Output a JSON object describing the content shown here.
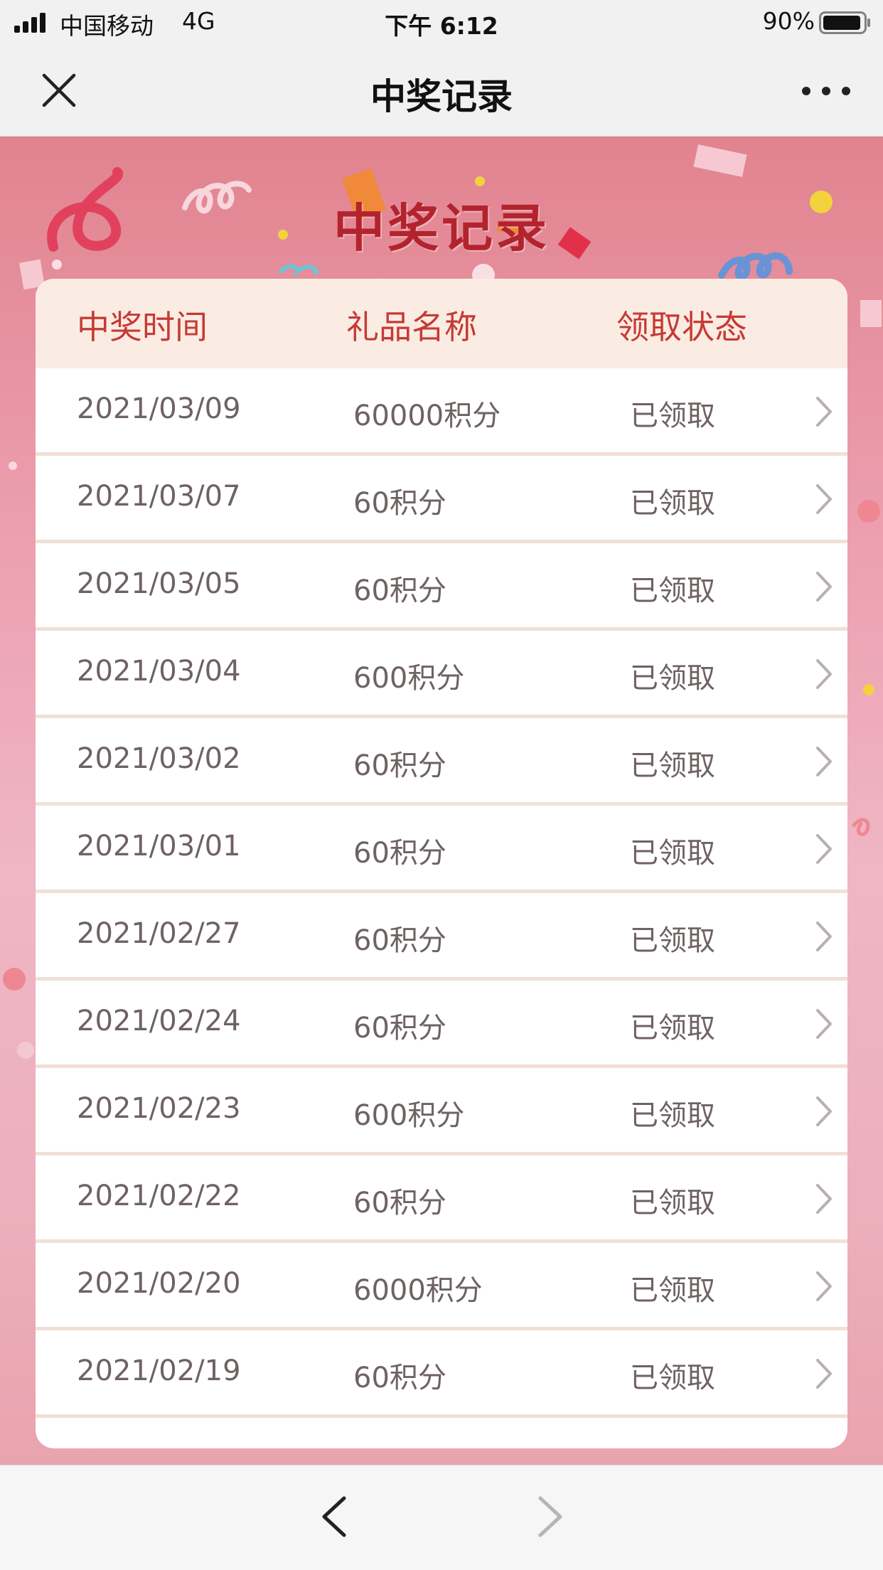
{
  "status_bar": {
    "carrier": "中国移动",
    "network": "4G",
    "time": "下午 6:12",
    "battery": "90%"
  },
  "nav": {
    "title": "中奖记录",
    "close_icon": "close-icon",
    "more_icon": "more-icon"
  },
  "banner": {
    "title": "中奖记录"
  },
  "table": {
    "headers": {
      "time": "中奖时间",
      "gift": "礼品名称",
      "status": "领取状态"
    },
    "rows": [
      {
        "date": "2021/03/09",
        "gift": "60000积分",
        "status": "已领取"
      },
      {
        "date": "2021/03/07",
        "gift": "60积分",
        "status": "已领取"
      },
      {
        "date": "2021/03/05",
        "gift": "60积分",
        "status": "已领取"
      },
      {
        "date": "2021/03/04",
        "gift": "600积分",
        "status": "已领取"
      },
      {
        "date": "2021/03/02",
        "gift": "60积分",
        "status": "已领取"
      },
      {
        "date": "2021/03/01",
        "gift": "60积分",
        "status": "已领取"
      },
      {
        "date": "2021/02/27",
        "gift": "60积分",
        "status": "已领取"
      },
      {
        "date": "2021/02/24",
        "gift": "60积分",
        "status": "已领取"
      },
      {
        "date": "2021/02/23",
        "gift": "600积分",
        "status": "已领取"
      },
      {
        "date": "2021/02/22",
        "gift": "60积分",
        "status": "已领取"
      },
      {
        "date": "2021/02/20",
        "gift": "6000积分",
        "status": "已领取"
      },
      {
        "date": "2021/02/19",
        "gift": "60积分",
        "status": "已领取"
      }
    ]
  },
  "toolbar": {
    "back_icon": "chevron-left-icon",
    "forward_icon": "chevron-right-icon"
  },
  "colors": {
    "accent": "#b3232e",
    "header_text": "#c63a35",
    "header_bg": "#fbece3",
    "row_text": "#6e6262"
  }
}
